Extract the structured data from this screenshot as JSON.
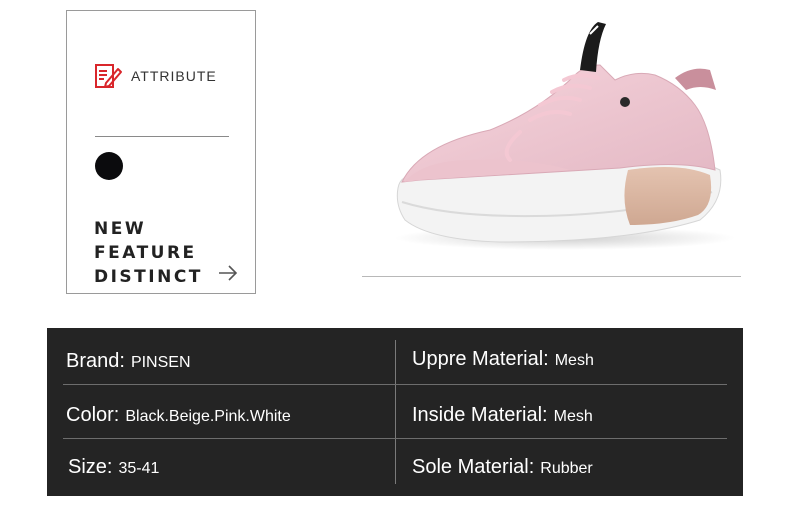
{
  "attribute_card": {
    "title": "ATTRIBUTE",
    "color_swatch": "#0b0b0d",
    "feature_lines": [
      "NEW",
      "FEATURE",
      "DISTINCT"
    ],
    "icon": "document-edit-icon",
    "arrow_icon": "arrow-right-icon"
  },
  "product_image": {
    "subject": "pink mesh sneaker with white sole and beige heel panel"
  },
  "specs": {
    "brand": {
      "label": "Brand:",
      "value": "PINSEN"
    },
    "upper": {
      "label": "Uppre Material:",
      "value": "Mesh"
    },
    "color": {
      "label": "Color:",
      "value": "Black.Beige.Pink.White"
    },
    "inside": {
      "label": "Inside Material:",
      "value": "Mesh"
    },
    "size": {
      "label": "Size:",
      "value": "35-41"
    },
    "sole": {
      "label": "Sole Material:",
      "value": "Rubber"
    }
  },
  "colors": {
    "panel_bg": "#242424",
    "accent_red": "#d9262b",
    "shoe_pink": "#f2c9d3"
  }
}
